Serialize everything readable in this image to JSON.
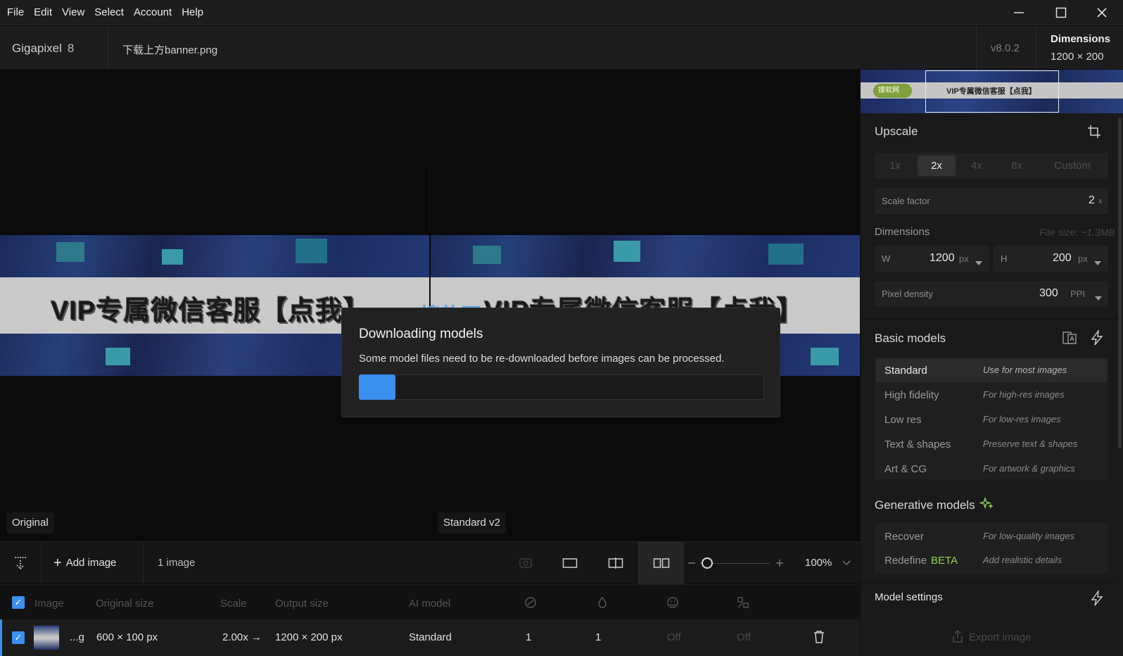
{
  "menubar": {
    "items": [
      "File",
      "Edit",
      "View",
      "Select",
      "Account",
      "Help"
    ]
  },
  "header": {
    "app_name": "Gigapixel",
    "app_version_major": "8",
    "file_name": "下载上方banner.png",
    "version": "v8.0.2",
    "dimensions_label": "Dimensions",
    "dimensions_value": "1200 × 200"
  },
  "canvas": {
    "banner_text": "VIP专属微信客服【点我】",
    "banner_text_right": "VIP专属微信客服【点我】",
    "watermark": "搜软网-www.secruan.com",
    "left_pane_label": "Original",
    "right_pane_label": "Standard v2"
  },
  "dialog": {
    "title": "Downloading models",
    "message": "Some model files need to be re-downloaded before images can be processed.",
    "progress": 0.09
  },
  "bottombar": {
    "add_image": "Add image",
    "image_count": "1 image",
    "zoom": "100%"
  },
  "table": {
    "headers": {
      "image": "Image",
      "original_size": "Original size",
      "scale": "Scale",
      "output_size": "Output size",
      "ai_model": "AI model"
    },
    "row": {
      "name": "...g",
      "original_size": "600 × 100 px",
      "scale": "2.00x →",
      "output_size": "1200 × 200 px",
      "ai_model": "Standard",
      "col1": "1",
      "col2": "1",
      "col3": "Off",
      "col4": "Off"
    }
  },
  "panel": {
    "thumb_badge": "搜软网",
    "thumb_text": "VIP专属微信客服【点我】",
    "upscale_title": "Upscale",
    "scale_options": [
      "1x",
      "2x",
      "4x",
      "6x",
      "Custom"
    ],
    "scale_selected": "2x",
    "scale_factor_label": "Scale factor",
    "scale_factor_value": "2",
    "scale_factor_unit": "x",
    "dimensions_title": "Dimensions",
    "file_size": "File size: ~1.3MB",
    "width_label": "W",
    "width_value": "1200",
    "width_unit": "px",
    "height_label": "H",
    "height_value": "200",
    "height_unit": "px",
    "pixel_density_label": "Pixel density",
    "pixel_density_value": "300",
    "pixel_density_unit": "PPI",
    "basic_models_title": "Basic models",
    "basic_models": [
      {
        "name": "Standard",
        "desc": "Use for most images"
      },
      {
        "name": "High fidelity",
        "desc": "For high-res images"
      },
      {
        "name": "Low res",
        "desc": "For low-res images"
      },
      {
        "name": "Text & shapes",
        "desc": "Preserve text & shapes"
      },
      {
        "name": "Art & CG",
        "desc": "For artwork & graphics"
      }
    ],
    "generative_models_title": "Generative models",
    "generative_models": [
      {
        "name": "Recover",
        "desc": "For low-quality images"
      },
      {
        "name": "Redefine",
        "badge": "BETA",
        "desc": "Add realistic details"
      }
    ],
    "model_settings_title": "Model settings",
    "export_label": "Export image"
  },
  "colors": {
    "accent": "#3b8fef",
    "beta": "#8fd14f"
  }
}
